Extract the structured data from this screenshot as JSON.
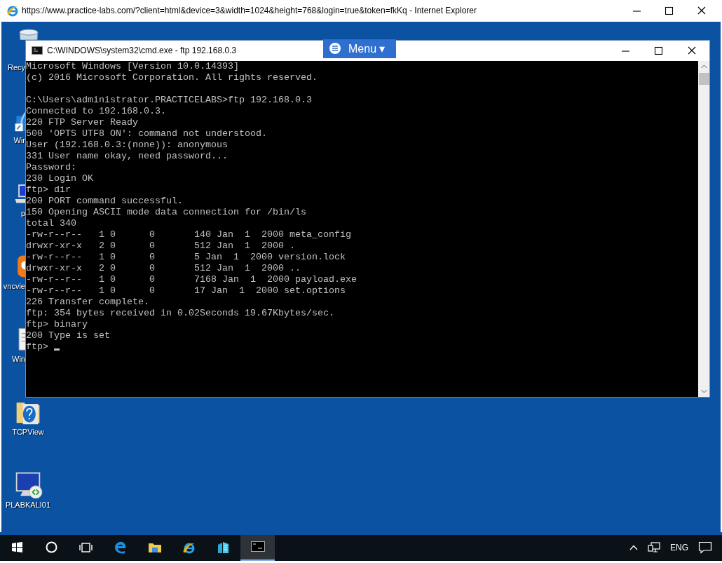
{
  "browser": {
    "title": "https://www.practice-labs.com/?client=html&device=3&width=1024&height=768&login=true&token=fkKq - Internet Explorer"
  },
  "desktop_icons": [
    {
      "kind": "bin",
      "label": "Recy",
      "cut": true
    },
    {
      "kind": "shortcut",
      "label": "Wir",
      "cut": true
    },
    {
      "kind": "laptop",
      "label": "p",
      "cut": true
    },
    {
      "kind": "vnc",
      "label": "vncvie",
      "cut": true
    },
    {
      "kind": "doc",
      "label": "Win",
      "cut": true
    },
    {
      "kind": "folder",
      "label": "TCPView",
      "cut": false
    },
    {
      "kind": "remote",
      "label": "PLABKALI01",
      "cut": false
    }
  ],
  "menu_button": {
    "label": "Menu ▾"
  },
  "console_window": {
    "title": "C:\\WINDOWS\\system32\\cmd.exe - ftp  192.168.0.3",
    "blocks": [
      [
        "Microsoft Windows [Version 10.0.14393]",
        "(c) 2016 Microsoft Corporation. All rights reserved."
      ],
      [
        "C:\\Users\\administrator.PRACTICELABS>ftp 192.168.0.3",
        "Connected to 192.168.0.3.",
        "220 FTP Server Ready",
        "500 'OPTS UTF8 ON': command not understood.",
        "User (192.168.0.3:(none)): anonymous",
        "331 User name okay, need password...",
        "Password:",
        "230 Login OK",
        "ftp> dir",
        "200 PORT command successful.",
        "150 Opening ASCII mode data connection for /bin/ls",
        "total 340",
        "-rw-r--r--   1 0      0       140 Jan  1  2000 meta_config",
        "drwxr-xr-x   2 0      0       512 Jan  1  2000 .",
        "-rw-r--r--   1 0      0       5 Jan  1  2000 version.lock",
        "drwxr-xr-x   2 0      0       512 Jan  1  2000 ..",
        "-rw-r--r--   1 0      0       7168 Jan  1  2000 payload.exe",
        "-rw-r--r--   1 0      0       17 Jan  1  2000 set.options",
        "226 Transfer complete.",
        "ftp: 354 bytes received in 0.02Seconds 19.67Kbytes/sec.",
        "ftp> binary",
        "200 Type is set"
      ]
    ],
    "prompt": "ftp> "
  },
  "taskbar": {
    "apps": [
      {
        "kind": "start",
        "selected": false
      },
      {
        "kind": "search",
        "selected": false
      },
      {
        "kind": "taskview",
        "selected": false
      },
      {
        "kind": "edge",
        "selected": false
      },
      {
        "kind": "explorer",
        "selected": false
      },
      {
        "kind": "ie",
        "selected": false
      },
      {
        "kind": "buildings",
        "selected": false
      },
      {
        "kind": "cmd",
        "selected": true
      }
    ],
    "language": "ENG"
  }
}
